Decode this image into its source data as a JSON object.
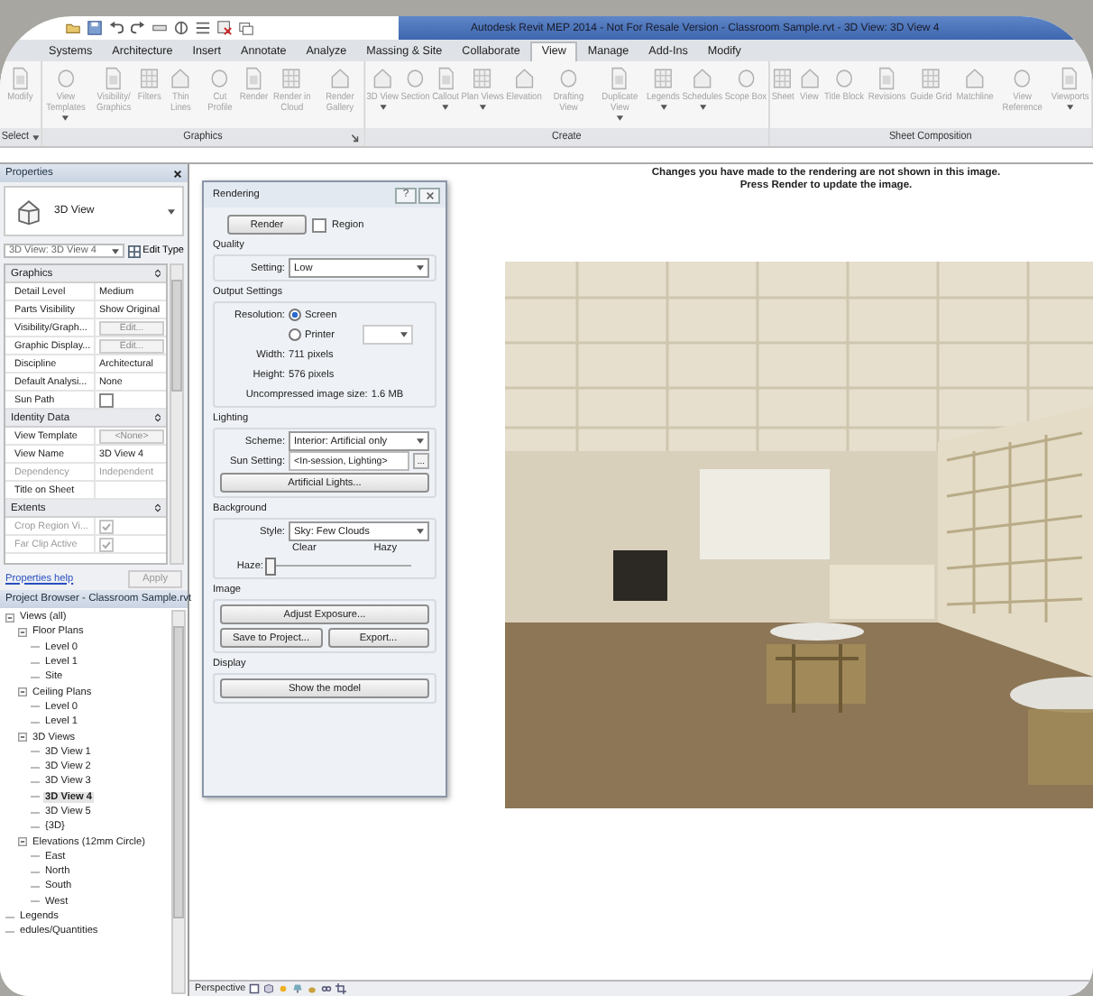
{
  "title_bar": {
    "title": "Autodesk Revit MEP 2014 - Not For Resale Version -    Classroom Sample.rvt - 3D View: 3D View 4"
  },
  "ribbon_tabs": [
    {
      "label": "Systems",
      "selected": false
    },
    {
      "label": "Architecture",
      "selected": false
    },
    {
      "label": "Insert",
      "selected": false
    },
    {
      "label": "Annotate",
      "selected": false
    },
    {
      "label": "Analyze",
      "selected": false
    },
    {
      "label": "Massing & Site",
      "selected": false
    },
    {
      "label": "Collaborate",
      "selected": false
    },
    {
      "label": "View",
      "selected": true
    },
    {
      "label": "Manage",
      "selected": false
    },
    {
      "label": "Add-Ins",
      "selected": false
    },
    {
      "label": "Modify",
      "selected": false
    }
  ],
  "ribbon_panels": [
    {
      "title": "Select",
      "dropdown": true,
      "launcher": false,
      "buttons": [
        {
          "label": "Modify",
          "dropdown": false
        }
      ]
    },
    {
      "title": "Graphics",
      "dropdown": false,
      "launcher": true,
      "buttons": [
        {
          "label": "View Templates",
          "dropdown": true
        },
        {
          "label": "Visibility/ Graphics",
          "dropdown": false
        },
        {
          "label": "Filters",
          "dropdown": false
        },
        {
          "label": "Thin Lines",
          "dropdown": false
        },
        {
          "label": "Cut Profile",
          "dropdown": false
        },
        {
          "label": "Render",
          "dropdown": false
        },
        {
          "label": "Render in Cloud",
          "dropdown": false
        },
        {
          "label": "Render Gallery",
          "dropdown": false
        }
      ]
    },
    {
      "title": "Create",
      "dropdown": false,
      "launcher": false,
      "buttons": [
        {
          "label": "3D View",
          "dropdown": true
        },
        {
          "label": "Section",
          "dropdown": false
        },
        {
          "label": "Callout",
          "dropdown": true
        },
        {
          "label": "Plan Views",
          "dropdown": true
        },
        {
          "label": "Elevation",
          "dropdown": false
        },
        {
          "label": "Drafting View",
          "dropdown": false
        },
        {
          "label": "Duplicate View",
          "dropdown": true
        },
        {
          "label": "Legends",
          "dropdown": true
        },
        {
          "label": "Schedules",
          "dropdown": true
        },
        {
          "label": "Scope Box",
          "dropdown": false
        }
      ]
    },
    {
      "title": "Sheet Composition",
      "dropdown": false,
      "launcher": false,
      "buttons": [
        {
          "label": "Sheet",
          "dropdown": false
        },
        {
          "label": "View",
          "dropdown": false
        },
        {
          "label": "Title Block",
          "dropdown": false
        },
        {
          "label": "Revisions",
          "dropdown": false
        },
        {
          "label": "Guide Grid",
          "dropdown": false
        },
        {
          "label": "Matchline",
          "dropdown": false
        },
        {
          "label": "View Reference",
          "dropdown": false
        },
        {
          "label": "Viewports",
          "dropdown": true
        }
      ]
    }
  ],
  "properties": {
    "title": "Properties",
    "type_name": "3D View",
    "instance": "3D View: 3D View 4",
    "edit_type": "Edit Type",
    "groups": [
      {
        "title": "Graphics",
        "rows": [
          {
            "label": "Detail Level",
            "kind": "text",
            "value": "Medium",
            "disabled": false
          },
          {
            "label": "Parts Visibility",
            "kind": "text",
            "value": "Show Original",
            "disabled": false
          },
          {
            "label": "Visibility/Graph...",
            "kind": "button",
            "value": "Edit...",
            "disabled": false
          },
          {
            "label": "Graphic Display...",
            "kind": "button",
            "value": "Edit...",
            "disabled": false
          },
          {
            "label": "Discipline",
            "kind": "text",
            "value": "Architectural",
            "disabled": false
          },
          {
            "label": "Default Analysi...",
            "kind": "text",
            "value": "None",
            "disabled": false
          },
          {
            "label": "Sun Path",
            "kind": "checkbox",
            "checked": false,
            "disabled": false
          }
        ]
      },
      {
        "title": "Identity Data",
        "rows": [
          {
            "label": "View Template",
            "kind": "button",
            "value": "<None>",
            "disabled": false
          },
          {
            "label": "View Name",
            "kind": "text",
            "value": "3D View 4",
            "disabled": false
          },
          {
            "label": "Dependency",
            "kind": "text",
            "value": "Independent",
            "disabled": true
          },
          {
            "label": "Title on Sheet",
            "kind": "text",
            "disabled": false
          }
        ]
      },
      {
        "title": "Extents",
        "rows": [
          {
            "label": "Crop Region Vi...",
            "kind": "checkbox",
            "checked": true,
            "disabled": true
          },
          {
            "label": "Far Clip Active",
            "kind": "checkbox",
            "checked": true,
            "disabled": true
          }
        ]
      }
    ],
    "help_link": "Properties help",
    "apply": "Apply"
  },
  "project_browser": {
    "title": "Project Browser - Classroom Sample.rvt",
    "items": [
      {
        "label": "Views (all)",
        "expanded": true,
        "selected": false,
        "children": [
          {
            "label": "Floor Plans",
            "expanded": true,
            "selected": false,
            "children": [
              {
                "label": "Level 0",
                "selected": false
              },
              {
                "label": "Level 1",
                "selected": false
              },
              {
                "label": "Site",
                "selected": false
              }
            ]
          },
          {
            "label": "Ceiling Plans",
            "expanded": true,
            "selected": false,
            "children": [
              {
                "label": "Level 0",
                "selected": false
              },
              {
                "label": "Level 1",
                "selected": false
              }
            ]
          },
          {
            "label": "3D Views",
            "expanded": true,
            "selected": false,
            "children": [
              {
                "label": "3D View 1",
                "selected": false
              },
              {
                "label": "3D View 2",
                "selected": false
              },
              {
                "label": "3D View 3",
                "selected": false
              },
              {
                "label": "3D View 4",
                "selected": true
              },
              {
                "label": "3D View 5",
                "selected": false
              },
              {
                "label": "{3D}",
                "selected": false
              }
            ]
          },
          {
            "label": "Elevations (12mm Circle)",
            "expanded": true,
            "selected": false,
            "children": [
              {
                "label": "East",
                "selected": false
              },
              {
                "label": "North",
                "selected": false
              },
              {
                "label": "South",
                "selected": false
              },
              {
                "label": "West",
                "selected": false
              }
            ]
          }
        ]
      },
      {
        "label": "Legends",
        "selected": false
      },
      {
        "label": "edules/Quantities",
        "selected": false
      }
    ]
  },
  "rendering_dialog": {
    "title": "Rendering",
    "help": "?",
    "render": "Render",
    "region": {
      "label": "Region",
      "checked": false
    },
    "quality": {
      "title": "Quality",
      "setting_label": "Setting:",
      "setting": "Low"
    },
    "output": {
      "title": "Output Settings",
      "resolution_label": "Resolution:",
      "options": [
        {
          "label": "Screen",
          "selected": true
        },
        {
          "label": "Printer",
          "selected": false
        }
      ],
      "width_label": "Width:",
      "width": "711 pixels",
      "height_label": "Height:",
      "height": "576 pixels",
      "size_label": "Uncompressed image size:",
      "size": "1.6 MB"
    },
    "lighting": {
      "title": "Lighting",
      "scheme_label": "Scheme:",
      "scheme": "Interior: Artificial only",
      "sun_label": "Sun Setting:",
      "sun": "<In-session, Lighting>",
      "sun_more": "...",
      "artificial": "Artificial Lights..."
    },
    "background": {
      "title": "Background",
      "style_label": "Style:",
      "style": "Sky: Few Clouds",
      "clear": "Clear",
      "hazy": "Hazy",
      "haze_label": "Haze:",
      "haze": {
        "level": 0
      }
    },
    "image": {
      "title": "Image",
      "adjust": "Adjust Exposure...",
      "save": "Save to Project...",
      "export": "Export..."
    },
    "display": {
      "title": "Display",
      "show": "Show the model"
    }
  },
  "canvas": {
    "message": [
      "Changes you have made to the rendering are not shown in this image.",
      "Press Render to update the image."
    ],
    "image": {
      "kind": "picture"
    }
  },
  "view_control_bar": {
    "view_type": "Perspective"
  }
}
